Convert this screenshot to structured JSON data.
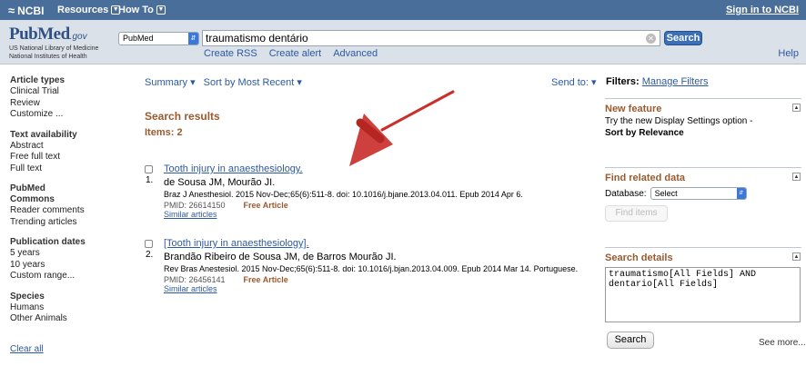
{
  "ncbi_bar": {
    "logo": "NCBI",
    "resources": "Resources",
    "howto": "How To",
    "signin": "Sign in to NCBI"
  },
  "header": {
    "logo_word": "PubMed",
    "logo_gov": ".gov",
    "logo_sub1": "US National Library of Medicine",
    "logo_sub2": "National Institutes of Health",
    "database": "PubMed",
    "term": "traumatismo dentário",
    "search_label": "Search",
    "links": [
      "Create RSS",
      "Create alert",
      "Advanced"
    ],
    "help": "Help"
  },
  "sidebar": {
    "groups": [
      {
        "title": "Article types",
        "items": [
          "Clinical Trial",
          "Review",
          "Customize ..."
        ]
      },
      {
        "title": "Text availability",
        "items": [
          "Abstract",
          "Free full text",
          "Full text"
        ]
      },
      {
        "title": "PubMed Commons",
        "title2": "Commons",
        "title1": "PubMed",
        "items": [
          "Reader comments",
          "Trending articles"
        ]
      },
      {
        "title": "Publication dates",
        "items": [
          "5 years",
          "10 years",
          "Custom range..."
        ]
      },
      {
        "title": "Species",
        "items": [
          "Humans",
          "Other Animals"
        ]
      }
    ],
    "clear_all": "Clear all"
  },
  "toolbar": {
    "summary": "Summary",
    "sort": "Sort by Most Recent",
    "sendto": "Send to:"
  },
  "results": {
    "heading": "Search results",
    "count_label": "Items: 2",
    "items": [
      {
        "num": "1.",
        "title": "Tooth injury in anaesthesiology.",
        "authors": "de Sousa JM, Mourão JI.",
        "citation": "Braz J Anesthesiol. 2015 Nov-Dec;65(6):511-8. doi: 10.1016/j.bjane.2013.04.011. Epub 2014 Apr 6.",
        "pmid": "PMID: 26614150",
        "free": "Free Article",
        "similar": "Similar articles"
      },
      {
        "num": "2.",
        "title": "[Tooth injury in anaesthesiology].",
        "authors": "Brandão Ribeiro de Sousa JM, de Barros Mourão JI.",
        "citation": "Rev Bras Anestesiol. 2015 Nov-Dec;65(6):511-8. doi: 10.1016/j.bjan.2013.04.009. Epub 2014 Mar 14. Portuguese.",
        "pmid": "PMID: 26456141",
        "free": "Free Article",
        "similar": "Similar articles"
      }
    ]
  },
  "right_panel": {
    "filters_label": "Filters:",
    "manage_filters": "Manage Filters",
    "new_feature": {
      "heading": "New feature",
      "text": "Try the new Display Settings option -",
      "bold": "Sort by Relevance"
    },
    "related": {
      "heading": "Find related data",
      "db_label": "Database:",
      "db_value": "Select",
      "find_btn": "Find items"
    },
    "details": {
      "heading": "Search details",
      "query": "traumatismo[All Fields] AND dentario[All Fields]",
      "search_btn": "Search",
      "see_more": "See more..."
    }
  },
  "colors": {
    "ncbi_bar": "#4a6e9a",
    "header_bg": "#dbe1e9",
    "link": "#2c5aa0",
    "heading_brown": "#9a5a2d",
    "annotation_red": "#c9302c"
  }
}
